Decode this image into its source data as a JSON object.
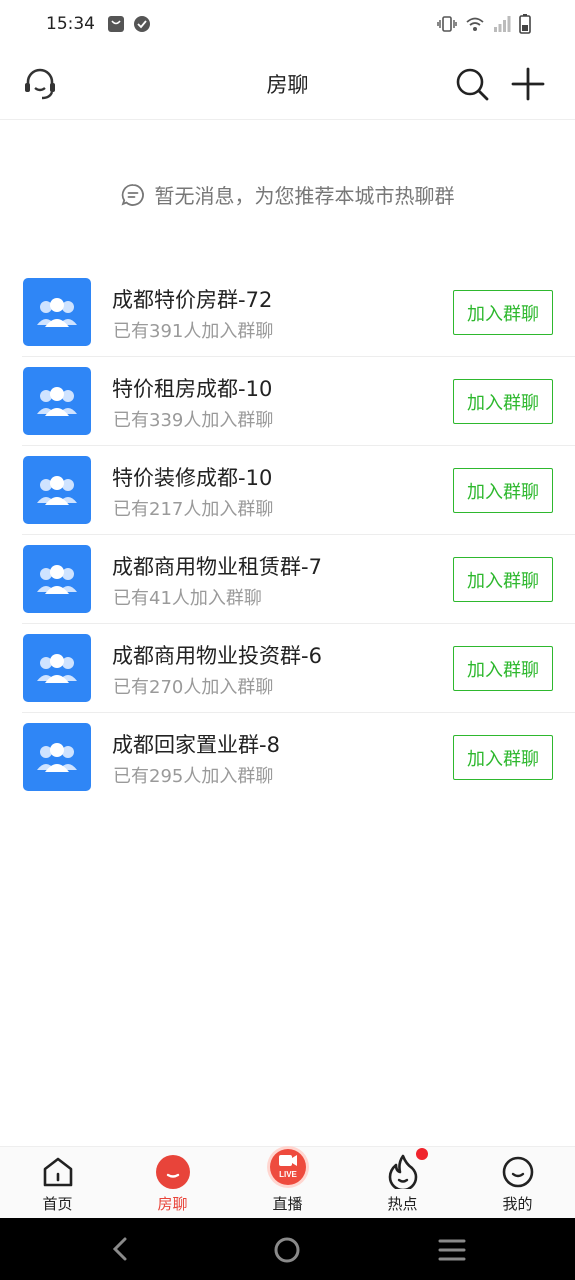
{
  "status_bar": {
    "time": "15:34"
  },
  "header": {
    "title": "房聊"
  },
  "empty_hint": {
    "text": "暂无消息，为您推荐本城市热聊群"
  },
  "groups": [
    {
      "name": "成都特价房群-72",
      "count": "已有391人加入群聊",
      "join_label": "加入群聊"
    },
    {
      "name": "特价租房成都-10",
      "count": "已有339人加入群聊",
      "join_label": "加入群聊"
    },
    {
      "name": "特价装修成都-10",
      "count": "已有217人加入群聊",
      "join_label": "加入群聊"
    },
    {
      "name": "成都商用物业租赁群-7",
      "count": "已有41人加入群聊",
      "join_label": "加入群聊"
    },
    {
      "name": "成都商用物业投资群-6",
      "count": "已有270人加入群聊",
      "join_label": "加入群聊"
    },
    {
      "name": "成都回家置业群-8",
      "count": "已有295人加入群聊",
      "join_label": "加入群聊"
    }
  ],
  "tabs": [
    {
      "label": "首页",
      "icon": "home-icon",
      "active": false
    },
    {
      "label": "房聊",
      "icon": "chat-bubble-icon",
      "active": true
    },
    {
      "label": "直播",
      "icon": "live-icon",
      "active": false
    },
    {
      "label": "热点",
      "icon": "flame-icon",
      "active": false,
      "badge": true
    },
    {
      "label": "我的",
      "icon": "profile-icon",
      "active": false
    }
  ],
  "colors": {
    "accent_blue": "#2f86f6",
    "join_green": "#2eb82e",
    "active_red": "#e8443a",
    "badge_red": "#f0242c"
  }
}
